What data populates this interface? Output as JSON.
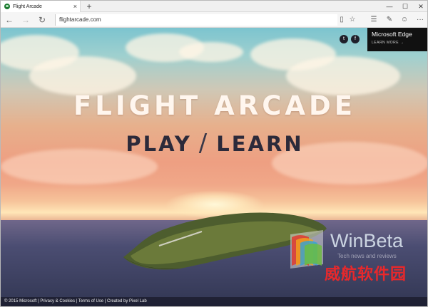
{
  "tab": {
    "title": "Flight Arcade",
    "close": "×"
  },
  "new_tab": "+",
  "window_controls": {
    "minimize": "—",
    "maximize": "☐",
    "close": "✕"
  },
  "nav": {
    "back": "←",
    "forward": "→",
    "refresh": "↻"
  },
  "address": {
    "url": "flightarcade.com"
  },
  "toolbar_icons": [
    "reading-view-icon",
    "favorite-star-icon",
    "hub-icon",
    "web-note-icon",
    "feedback-smiley-icon",
    "more-icon"
  ],
  "toolbar_glyphs": {
    "reading": "▯",
    "star": "☆",
    "hub": "☰",
    "note": "✎",
    "feedback": "☺",
    "more": "···"
  },
  "page": {
    "logo": "FLIGHT ARCADE",
    "play": "PLAY",
    "slash": "/",
    "learn": "LEARN",
    "social": {
      "twitter": "t",
      "facebook": "f"
    },
    "edge_promo": {
      "name": "Microsoft Edge",
      "learn_more": "LEARN MORE →"
    },
    "footer": "© 2015 Microsoft | Privacy & Cookies | Terms of Use | Created by Pixel Lab"
  },
  "watermark": {
    "brand": "WinBeta",
    "sub": "Tech news and reviews",
    "cn": "威航软件园"
  },
  "colors": {
    "accent_dark": "#111111",
    "watermark_red": "#e8282b",
    "logo_text": "#fff6ee",
    "subtitle_text": "#2c2a3a"
  }
}
